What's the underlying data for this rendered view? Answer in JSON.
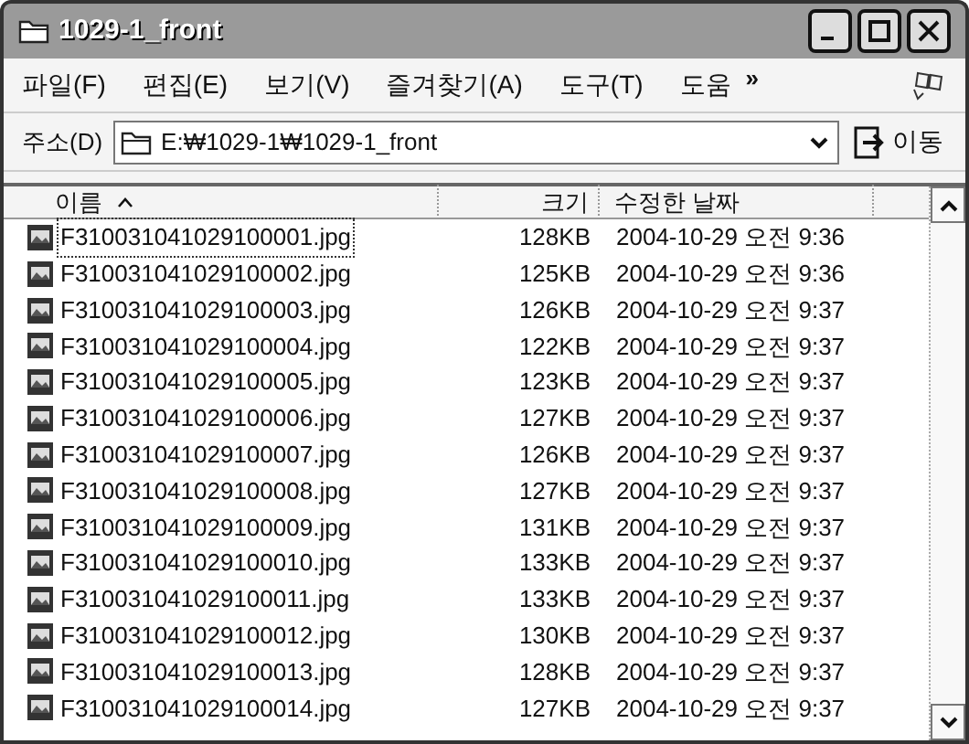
{
  "window": {
    "title": "1029-1_front"
  },
  "menu": {
    "items": [
      "파일(F)",
      "편집(E)",
      "보기(V)",
      "즐겨찾기(A)",
      "도구(T)",
      "도움"
    ],
    "overflow": "»"
  },
  "address": {
    "label": "주소(D)",
    "value": "E:₩1029-1₩1029-1_front",
    "go": "이동"
  },
  "table": {
    "columns": [
      "이름",
      "크기",
      "수정한 날짜"
    ],
    "rows": [
      {
        "name": "F310031041029100001.jpg",
        "size": "128KB",
        "date": "2004-10-29 오전 9:36",
        "focused": true
      },
      {
        "name": "F310031041029100002.jpg",
        "size": "125KB",
        "date": "2004-10-29 오전 9:36",
        "focused": false
      },
      {
        "name": "F310031041029100003.jpg",
        "size": "126KB",
        "date": "2004-10-29 오전 9:37",
        "focused": false
      },
      {
        "name": "F310031041029100004.jpg",
        "size": "122KB",
        "date": "2004-10-29 오전 9:37",
        "focused": false
      },
      {
        "name": "F310031041029100005.jpg",
        "size": "123KB",
        "date": "2004-10-29 오전 9:37",
        "focused": false
      },
      {
        "name": "F310031041029100006.jpg",
        "size": "127KB",
        "date": "2004-10-29 오전 9:37",
        "focused": false
      },
      {
        "name": "F310031041029100007.jpg",
        "size": "126KB",
        "date": "2004-10-29 오전 9:37",
        "focused": false
      },
      {
        "name": "F310031041029100008.jpg",
        "size": "127KB",
        "date": "2004-10-29 오전 9:37",
        "focused": false
      },
      {
        "name": "F310031041029100009.jpg",
        "size": "131KB",
        "date": "2004-10-29 오전 9:37",
        "focused": false
      },
      {
        "name": "F310031041029100010.jpg",
        "size": "133KB",
        "date": "2004-10-29 오전 9:37",
        "focused": false
      },
      {
        "name": "F310031041029100011.jpg",
        "size": "133KB",
        "date": "2004-10-29 오전 9:37",
        "focused": false
      },
      {
        "name": "F310031041029100012.jpg",
        "size": "130KB",
        "date": "2004-10-29 오전 9:37",
        "focused": false
      },
      {
        "name": "F310031041029100013.jpg",
        "size": "128KB",
        "date": "2004-10-29 오전 9:37",
        "focused": false
      },
      {
        "name": "F310031041029100014.jpg",
        "size": "127KB",
        "date": "2004-10-29 오전 9:37",
        "focused": false
      }
    ]
  }
}
